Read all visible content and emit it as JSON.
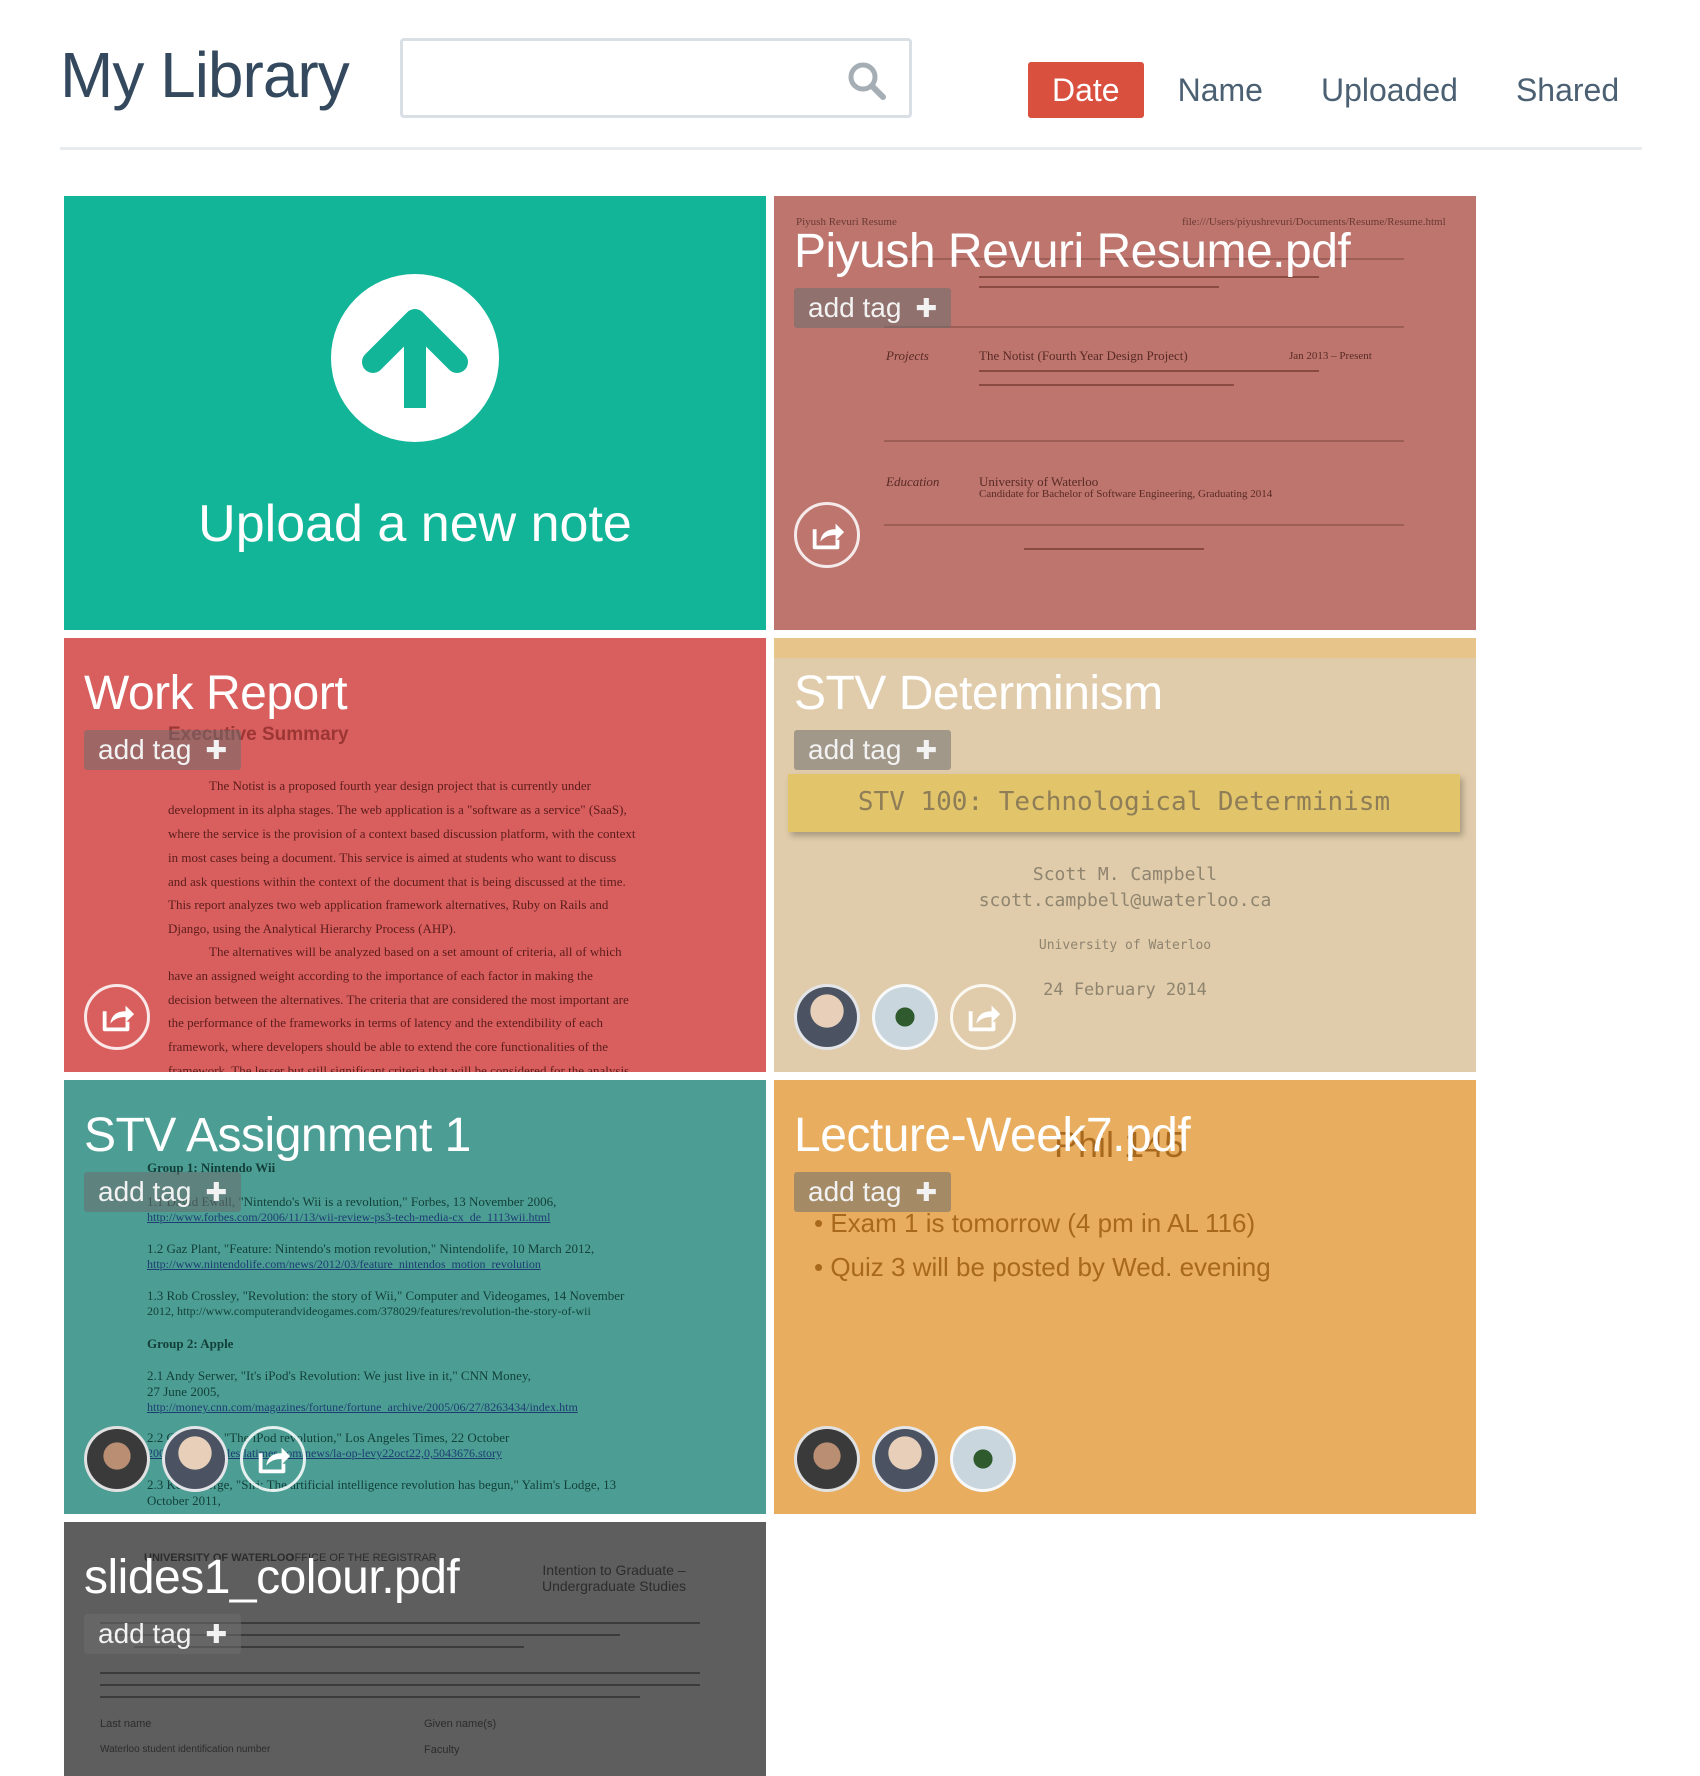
{
  "header": {
    "title": "My Library",
    "search_placeholder": "",
    "sort_tabs": [
      "Date",
      "Name",
      "Uploaded",
      "Shared"
    ]
  },
  "upload": {
    "label": "Upload a new note"
  },
  "tag_label": "add tag",
  "notes": [
    {
      "title": "Piyush Revuri Resume.pdf",
      "color": "#bd756e",
      "doc": {
        "header_left": "Piyush Revuri Resume",
        "header_right": "file:///Users/piyushrevuri/Documents/Resume/Resume.html",
        "projects_label": "Projects",
        "project_title": "The Notist (Fourth Year Design Project)",
        "project_date": "Jan 2013 – Present",
        "education_label": "Education",
        "school": "University of Waterloo",
        "degree": "Candidate for Bachelor of Software Engineering, Graduating 2014"
      }
    },
    {
      "title": "Work Report",
      "color": "#d95f5e",
      "doc": {
        "heading": "Executive Summary",
        "lines": [
          "The Notist is a proposed fourth year design project that is currently under",
          "development in its alpha stages. The web application is a \"software as a service\" (SaaS),",
          "where the service is the provision of a context based discussion platform, with the context",
          "in most cases being a document. This service is aimed at students who want to discuss",
          "and ask questions within the context of the document that is being discussed at the time.",
          "This report analyzes two web application framework alternatives, Ruby on Rails and",
          "Django, using the Analytical Hierarchy Process (AHP).",
          "The alternatives will be analyzed based on a set amount of criteria, all of which",
          "have an assigned weight according to the importance of each factor in making the",
          "decision between the alternatives. The criteria that are considered the most important are",
          "the performance of the frameworks in terms of latency and the extendibility of each",
          "framework, where developers should be able to extend the core functionalities of the",
          "framework. The lesser but still significant criteria that will be considered for the analysis"
        ]
      }
    },
    {
      "title": "STV Determinism",
      "color": "#e0ccaa",
      "doc": {
        "banner": "STV 100: Technological Determinism",
        "author": "Scott M. Campbell",
        "email": "scott.campbell@uwaterloo.ca",
        "school": "University of Waterloo",
        "date": "24 February 2014"
      }
    },
    {
      "title": "STV Assignment 1",
      "color": "#4c9e94",
      "doc": {
        "lines": [
          "Group 1: Nintendo Wii",
          "1.1 David Ewall, \"Nintendo's Wii is a revolution,\" Forbes, 13 November 2006,",
          "http://www.forbes.com/2006/11/13/wii-review-ps3-tech-media-cx_de_1113wii.html",
          "1.2 Gaz Plant, \"Feature: Nintendo's motion revolution,\" Nintendolife, 10 March 2012,",
          "http://www.nintendolife.com/news/2012/03/feature_nintendos_motion_revolution",
          "1.3 Rob Crossley, \"Revolution: the story of Wii,\" Computer and Videogames, 14 November",
          "2012, http://www.computerandvideogames.com/378029/features/revolution-the-story-of-wii",
          "Group 2: Apple",
          "2.1 Andy Serwer, \"It's iPod's Revolution: We just live in it,\" CNN Money,",
          "27 June 2005,",
          "http://money.cnn.com/magazines/fortune/fortune_archive/2005/06/27/8263434/index.htm",
          "2.2 Chris Lee, \"The iPod revolution,\" Los Angeles Times, 22 October",
          "2006, http://articles.latimes.com/news/la-op-levy22oct22,0,5043676.story",
          "2.3 Ken George, \"Siri: The artificial intelligence revolution has begun,\" Yalim's Lodge, 13",
          "October 2011,"
        ]
      }
    },
    {
      "title": "Lecture-Week7.pdf",
      "color": "#e8ad5e",
      "doc": {
        "heading": "Phil 145",
        "bullets": [
          "Exam 1 is tomorrow (4 pm in AL 116)",
          "Quiz 3 will be posted by Wed. evening"
        ]
      }
    },
    {
      "title": "slides1_colour.pdf",
      "color": "#5e5e5e",
      "doc": {
        "org": "UNIVERSITY OF WATERLOO",
        "office": "OFFICE OF THE REGISTRAR",
        "form_title": "Intention to Graduate – Undergraduate Studies",
        "label_surname": "Last name",
        "label_given": "Given name(s)",
        "label_student": "Waterloo student identification number",
        "label_faculty": "Faculty"
      }
    }
  ]
}
